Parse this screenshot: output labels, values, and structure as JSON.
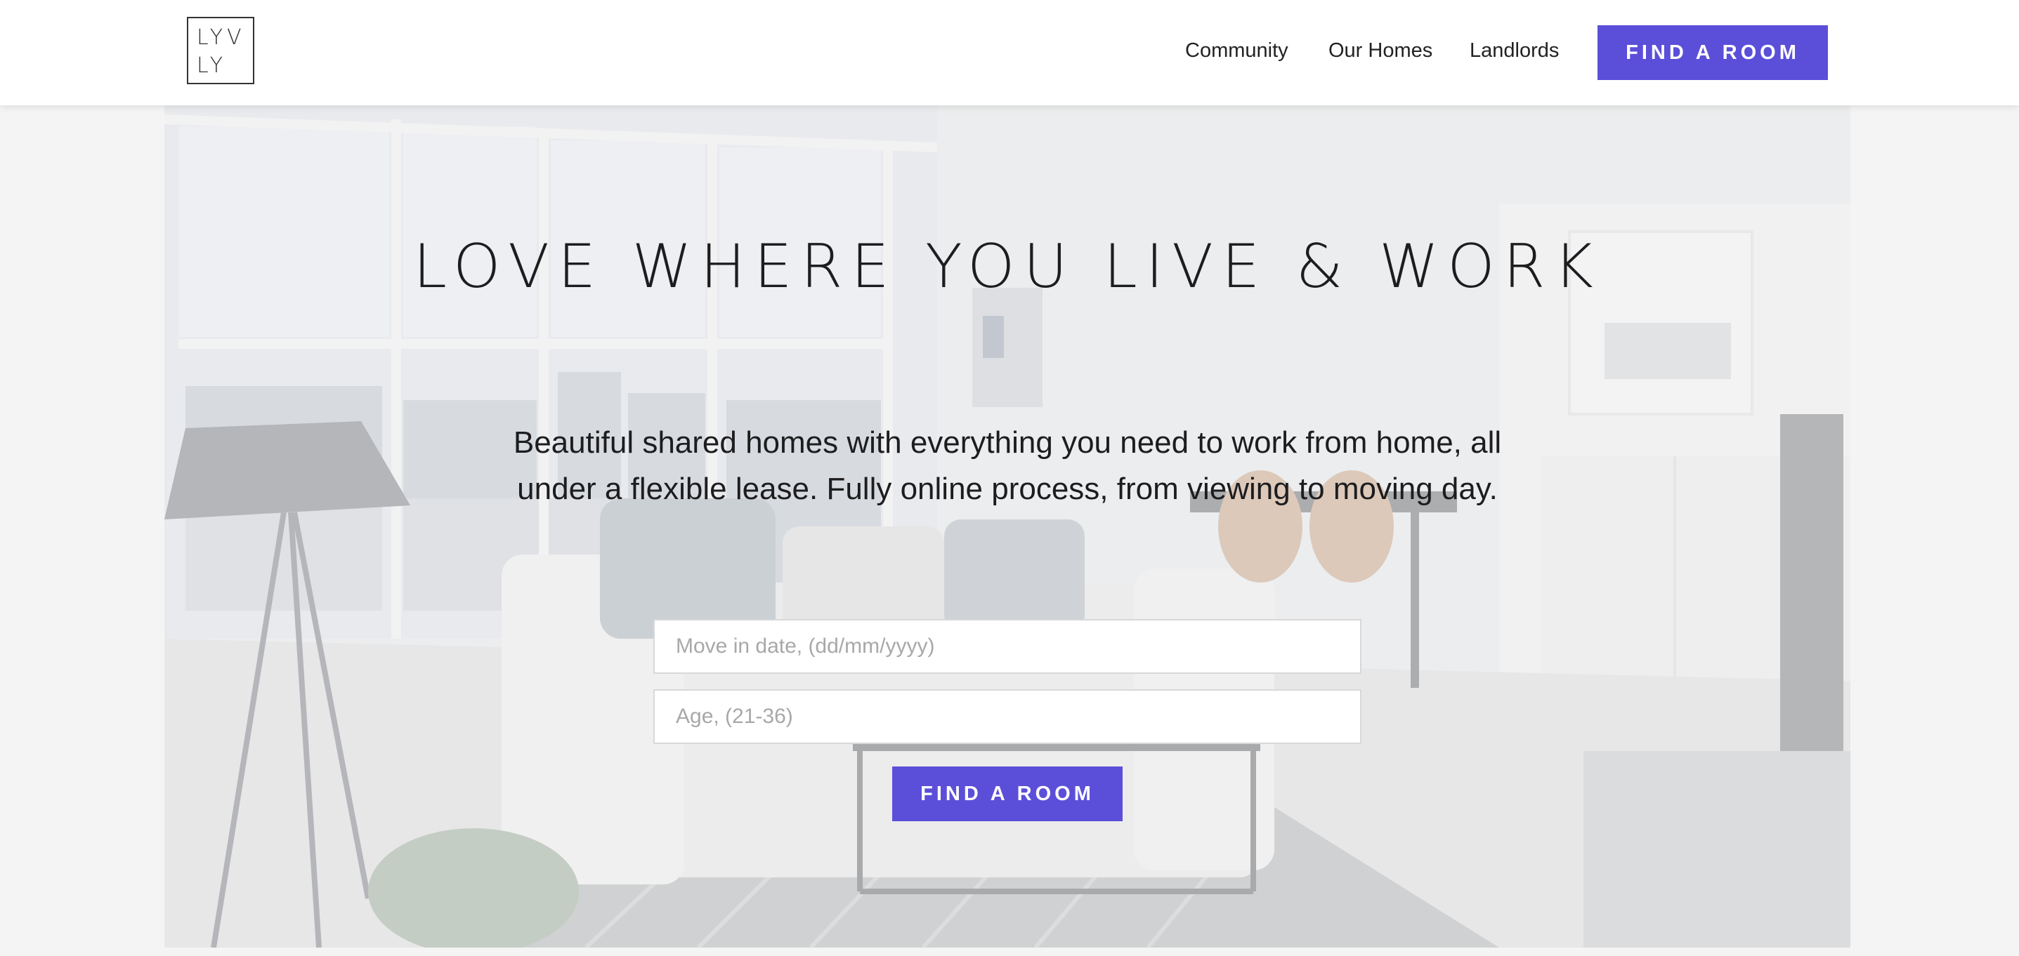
{
  "header": {
    "logo": {
      "line1": "LYV",
      "line2": "LY"
    },
    "nav": [
      {
        "label": "Community"
      },
      {
        "label": "Our Homes"
      },
      {
        "label": "Landlords"
      }
    ],
    "cta_label": "FIND A ROOM"
  },
  "hero": {
    "title": "LOVE WHERE YOU LIVE & WORK",
    "subtitle_line1": "Beautiful shared homes with everything you need to work from home, all",
    "subtitle_line2": "under a flexible lease. Fully online process, from viewing to moving day.",
    "form": {
      "move_in_placeholder": "Move in date, (dd/mm/yyyy)",
      "age_placeholder": "Age, (21-36)",
      "submit_label": "FIND A ROOM"
    }
  },
  "colors": {
    "accent": "#5b4fd9",
    "page_background": "#f4f4f4",
    "header_background": "#ffffff",
    "text": "#1d1d1f"
  }
}
